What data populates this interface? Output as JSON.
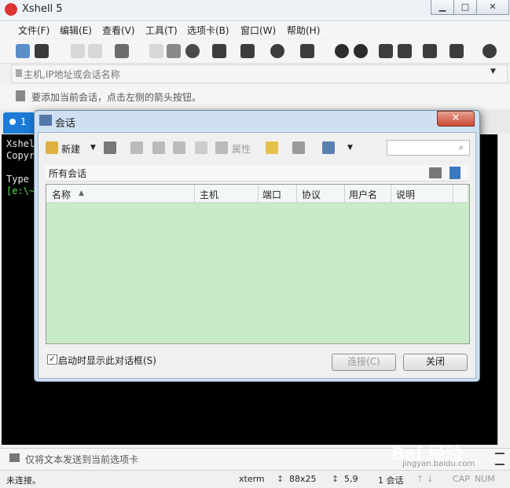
{
  "window": {
    "title": "Xshell 5",
    "controls": {
      "minimize": "▁",
      "maximize": "□",
      "close": "✕"
    }
  },
  "menubar": [
    "文件(F)",
    "编辑(E)",
    "查看(V)",
    "工具(T)",
    "选项卡(B)",
    "窗口(W)",
    "帮助(H)"
  ],
  "address": {
    "placeholder": "主机,IP地址或会话名称",
    "dropdown": "▼"
  },
  "hint": "要添加当前会话，点击左侧的箭头按钮。",
  "tab": {
    "label": "1"
  },
  "terminal": {
    "lines": [
      "Xshel",
      "Copyr",
      "",
      "Type",
      "[e:\\~"
    ]
  },
  "sendbar": {
    "text": "仅将文本发送到当前选项卡"
  },
  "status": {
    "state": "未连接。",
    "term": "xterm",
    "size": "88x25",
    "pos": "5,9",
    "sessions": "1 会话",
    "caps": "CAP",
    "num": "NUM"
  },
  "watermark": {
    "main": "Bai 经验",
    "sub": "jingyan.baidu.com"
  },
  "dialog": {
    "title": "会话",
    "close": "✕",
    "toolbar": {
      "new": "新建",
      "properties": "属性"
    },
    "search_placeholder": "",
    "folder": "所有会话",
    "columns": [
      "名称",
      "主机",
      "端口",
      "协议",
      "用户名",
      "说明"
    ],
    "sort_indicator": "▲",
    "startup_checkbox": {
      "label": "启动时显示此对话框(S)",
      "checked": true,
      "mark": "✓"
    },
    "buttons": {
      "connect": "连接(C)",
      "close": "关闭"
    }
  },
  "colors": {
    "accent": "#1b7bd6",
    "list_bg": "#c8ecc8",
    "dialog_frame": "#cfe0f2",
    "close_red": "#c94a32"
  }
}
